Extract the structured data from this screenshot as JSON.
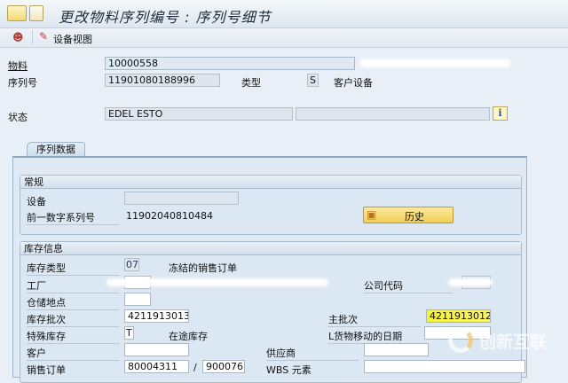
{
  "title": "更改物料序列编号 : 序列号细节",
  "toolbar": {
    "equipment_view": "设备视图"
  },
  "header": {
    "material_label": "物料",
    "material_value": "10000558",
    "serial_label": "序列号",
    "serial_value": "11901080188996",
    "type_label": "类型",
    "type_value": "S",
    "type_text": "客户设备",
    "status_label": "状态",
    "status_value": "EDEL ESTO"
  },
  "tabs": [
    {
      "label": "序列数据"
    }
  ],
  "general": {
    "title": "常规",
    "equipment_label": "设备",
    "equipment_value": "",
    "prev_serial_label": "前一数字系列号",
    "prev_serial_value": "11902040810484",
    "history_button": "历史"
  },
  "stock": {
    "title": "库存信息",
    "stock_type_label": "库存类型",
    "stock_type_value": "07",
    "stock_type_text": "冻结的销售订单",
    "plant_label": "工厂",
    "company_code_label": "公司代码",
    "storage_loc_label": "仓储地点",
    "stock_batch_label": "库存批次",
    "stock_batch_value": "4211913013",
    "main_batch_label": "主批次",
    "main_batch_value": "4211913012",
    "special_stock_label": "特殊库存",
    "special_stock_value": "T",
    "special_stock_text": "在途库存",
    "last_move_label": "L货物移动的日期",
    "customer_label": "客户",
    "vendor_label": "供应商",
    "sales_order_label": "销售订单",
    "sales_order_value": "80004311",
    "sales_item_sep": "/",
    "sales_item_value": "900076",
    "wbs_label": "WBS 元素"
  },
  "watermark": "创新互联",
  "colors": {
    "highlight": "#f5f23a",
    "button": "#f5d866"
  }
}
